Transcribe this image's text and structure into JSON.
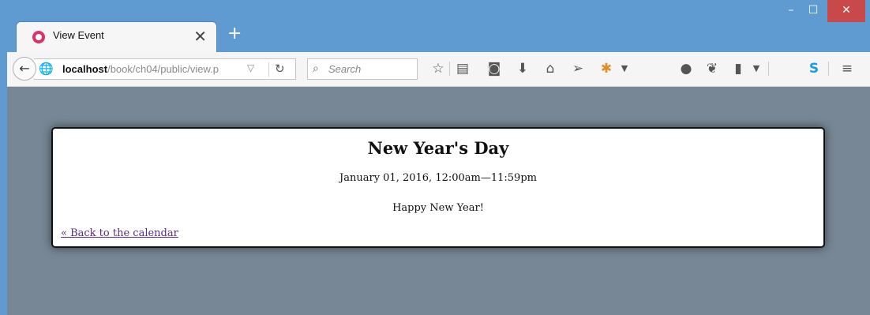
{
  "tab": {
    "title": "View Event",
    "close_glyph": "✕",
    "new_tab_glyph": "+"
  },
  "window_controls": {
    "minimize": "–",
    "maximize": "☐",
    "close": "✕"
  },
  "navbar": {
    "back_glyph": "←",
    "url_host": "localhost",
    "url_path": "/book/ch04/public/view.p",
    "search_placeholder": "Search",
    "icons": [
      "bookmark-star-icon",
      "reading-list-icon",
      "pocket-icon",
      "download-icon",
      "home-icon",
      "send-icon",
      "extension-icon",
      "chat-icon",
      "puzzle-icon",
      "clipboard-icon",
      "skype-icon",
      "menu-icon"
    ]
  },
  "event": {
    "title": "New Year's Day",
    "time": "January 01, 2016, 12:00am—11:59pm",
    "description": "Happy New Year!",
    "back_link": "« Back to the calendar"
  },
  "colors": {
    "titlebar": "#5f9bd1",
    "viewport": "#778795",
    "close_button": "#c9494a",
    "link": "#5b2a86"
  }
}
